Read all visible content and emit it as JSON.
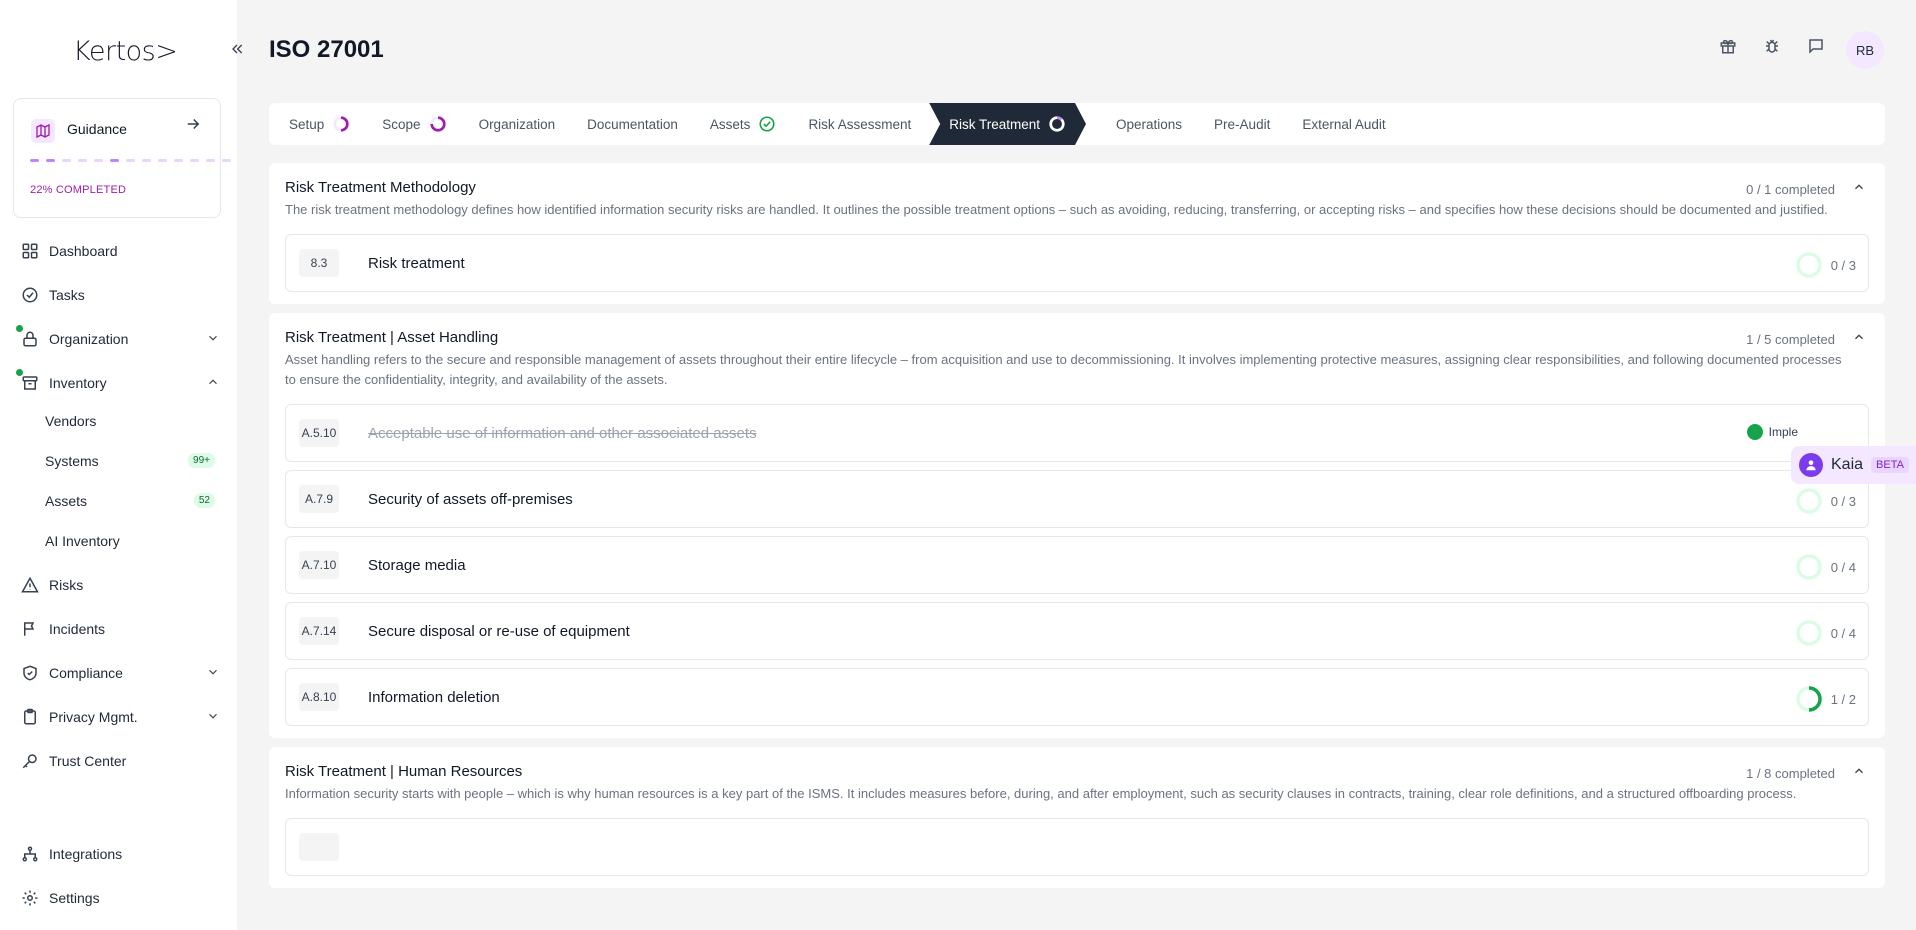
{
  "app": {
    "logo": "Kertos>"
  },
  "sidebar": {
    "guidance": {
      "label": "Guidance",
      "progress_text": "22% COMPLETED",
      "progress_fraction": 0.22
    },
    "items": [
      {
        "label": "Dashboard",
        "icon": "grid-icon"
      },
      {
        "label": "Tasks",
        "icon": "check-circle-icon"
      },
      {
        "label": "Organization",
        "icon": "lock-icon"
      },
      {
        "label": "Inventory",
        "icon": "archive-icon"
      },
      {
        "label": "Risks",
        "icon": "warning-icon"
      },
      {
        "label": "Incidents",
        "icon": "flag-icon"
      },
      {
        "label": "Compliance",
        "icon": "shield-check-icon"
      },
      {
        "label": "Privacy Mgmt.",
        "icon": "clipboard-icon"
      },
      {
        "label": "Trust Center",
        "icon": "key-icon"
      },
      {
        "label": "Integrations",
        "icon": "network-icon"
      },
      {
        "label": "Settings",
        "icon": "gear-icon"
      }
    ],
    "inventory_sub": [
      {
        "label": "Vendors",
        "badge": ""
      },
      {
        "label": "Systems",
        "badge": "99+"
      },
      {
        "label": "Assets",
        "badge": "52"
      },
      {
        "label": "AI Inventory",
        "badge": ""
      }
    ]
  },
  "header": {
    "title": "ISO 27001",
    "avatar_initials": "RB"
  },
  "steps": [
    {
      "label": "Setup",
      "status": "in-progress"
    },
    {
      "label": "Scope",
      "status": "in-progress"
    },
    {
      "label": "Organization",
      "status": "none"
    },
    {
      "label": "Documentation",
      "status": "none"
    },
    {
      "label": "Assets",
      "status": "done"
    },
    {
      "label": "Risk Assessment",
      "status": "none"
    },
    {
      "label": "Risk Treatment",
      "status": "active"
    },
    {
      "label": "Operations",
      "status": "none"
    },
    {
      "label": "Pre-Audit",
      "status": "none"
    },
    {
      "label": "External Audit",
      "status": "none"
    }
  ],
  "sections": [
    {
      "title": "Risk Treatment Methodology",
      "count": "0 / 1 completed",
      "description": "The risk treatment methodology defines how identified information security risks are handled. It outlines the possible treatment options – such as avoiding, reducing, transferring, or accepting risks – and specifies how these decisions should be documented and justified.",
      "controls": [
        {
          "id": "8.3",
          "name": "Risk treatment",
          "progress": "0 / 3"
        }
      ]
    },
    {
      "title": "Risk Treatment | Asset Handling",
      "count": "1 / 5 completed",
      "description": "Asset handling refers to the secure and responsible management of assets throughout their entire lifecycle – from acquisition and use to decommissioning. It involves implementing protective measures, assigning clear responsibilities, and following documented processes to ensure the confidentiality, integrity, and availability of the assets.",
      "controls": [
        {
          "id": "A.5.10",
          "name": "Acceptable use of information and other associated assets",
          "status": "Imple"
        },
        {
          "id": "A.7.9",
          "name": "Security of assets off-premises",
          "progress": "0 / 3"
        },
        {
          "id": "A.7.10",
          "name": "Storage media",
          "progress": "0 / 4"
        },
        {
          "id": "A.7.14",
          "name": "Secure disposal or re-use of equipment",
          "progress": "0 / 4"
        },
        {
          "id": "A.8.10",
          "name": "Information deletion",
          "progress": "1 / 2"
        }
      ]
    },
    {
      "title": "Risk Treatment | Human Resources",
      "count": "1 / 8 completed",
      "description": "Information security starts with people – which is why human resources is a key part of the ISMS. It includes measures before, during, and after employment, such as security clauses in contracts, training, clear role definitions, and a structured offboarding process."
    }
  ],
  "kaia": {
    "name": "Kaia",
    "tag": "BETA"
  },
  "colors": {
    "accent": "#a21caf",
    "active_step": "#1f2937",
    "success": "#16a34a"
  }
}
